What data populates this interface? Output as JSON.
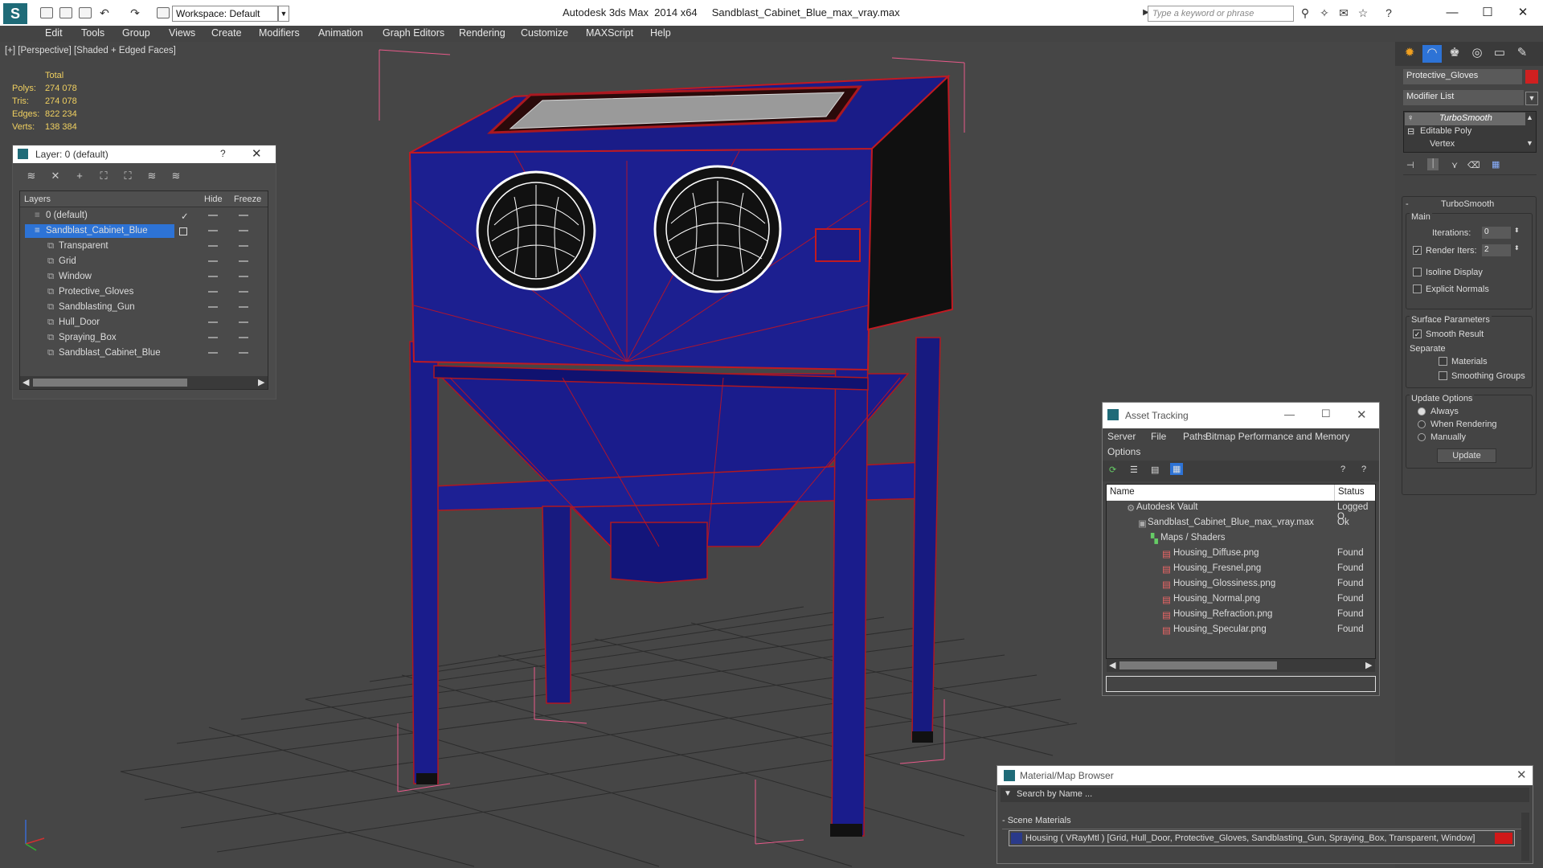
{
  "app": {
    "title": "Autodesk 3ds Max  2014 x64",
    "file": "Sandblast_Cabinet_Blue_max_vray.max",
    "workspace": "Workspace: Default",
    "search_placeholder": "Type a keyword or phrase"
  },
  "menu": [
    "Edit",
    "Tools",
    "Group",
    "Views",
    "Create",
    "Modifiers",
    "Animation",
    "Graph Editors",
    "Rendering",
    "Customize",
    "MAXScript",
    "Help"
  ],
  "viewport": {
    "label": "[+] [Perspective] [Shaded + Edged Faces]",
    "stats": {
      "header": "Total",
      "rows": [
        {
          "k": "Polys:",
          "v": "274 078"
        },
        {
          "k": "Tris:",
          "v": "274 078"
        },
        {
          "k": "Edges:",
          "v": "822 234"
        },
        {
          "k": "Verts:",
          "v": "138 384"
        }
      ]
    },
    "colors": {
      "model": "#1a1c8c",
      "wire": "#cc1a22",
      "bg": "#464646"
    }
  },
  "layer_panel": {
    "title": "Layer: 0 (default)",
    "help": "?",
    "columns": {
      "layers": "Layers",
      "hide": "Hide",
      "freeze": "Freeze"
    },
    "rows": [
      {
        "name": "0 (default)",
        "level": 0
      },
      {
        "name": "Sandblast_Cabinet_Blue",
        "level": 0,
        "selected": true
      },
      {
        "name": "Transparent",
        "level": 1
      },
      {
        "name": "Grid",
        "level": 1
      },
      {
        "name": "Window",
        "level": 1
      },
      {
        "name": "Protective_Gloves",
        "level": 1
      },
      {
        "name": "Sandblasting_Gun",
        "level": 1
      },
      {
        "name": "Hull_Door",
        "level": 1
      },
      {
        "name": "Spraying_Box",
        "level": 1
      },
      {
        "name": "Sandblast_Cabinet_Blue",
        "level": 1
      }
    ]
  },
  "command_panel": {
    "object_name": "Protective_Gloves",
    "modifier_list": "Modifier List",
    "stack": [
      "TurboSmooth",
      "Editable Poly",
      "Vertex"
    ],
    "rollout_title": "TurboSmooth",
    "main_label": "Main",
    "iterations_label": "Iterations:",
    "iterations_value": "0",
    "render_iters_label": "Render Iters:",
    "render_iters_value": "2",
    "isoline": "Isoline Display",
    "explicit": "Explicit Normals",
    "surface_params": "Surface Parameters",
    "smooth_result": "Smooth Result",
    "separate": "Separate",
    "materials": "Materials",
    "smoothing_groups": "Smoothing Groups",
    "update_options": "Update Options",
    "always": "Always",
    "when_rendering": "When Rendering",
    "manually": "Manually",
    "update": "Update"
  },
  "asset_tracking": {
    "title": "Asset Tracking",
    "menu": [
      "Server",
      "File",
      "Paths",
      "Bitmap Performance and Memory"
    ],
    "menu2": "Options",
    "columns": {
      "name": "Name",
      "status": "Status"
    },
    "rows": [
      {
        "name": "Autodesk Vault",
        "status": "Logged O",
        "indent": 0
      },
      {
        "name": "Sandblast_Cabinet_Blue_max_vray.max",
        "status": "Ok",
        "indent": 1
      },
      {
        "name": "Maps / Shaders",
        "status": "",
        "indent": 2
      },
      {
        "name": "Housing_Diffuse.png",
        "status": "Found",
        "indent": 3
      },
      {
        "name": "Housing_Fresnel.png",
        "status": "Found",
        "indent": 3
      },
      {
        "name": "Housing_Glossiness.png",
        "status": "Found",
        "indent": 3
      },
      {
        "name": "Housing_Normal.png",
        "status": "Found",
        "indent": 3
      },
      {
        "name": "Housing_Refraction.png",
        "status": "Found",
        "indent": 3
      },
      {
        "name": "Housing_Specular.png",
        "status": "Found",
        "indent": 3
      }
    ]
  },
  "material_browser": {
    "title": "Material/Map Browser",
    "search": "Search by Name ...",
    "section": "- Scene Materials",
    "item": "Housing  ( VRayMtl ) [Grid, Hull_Door, Protective_Gloves, Sandblasting_Gun, Spraying_Box, Transparent, Window]"
  }
}
